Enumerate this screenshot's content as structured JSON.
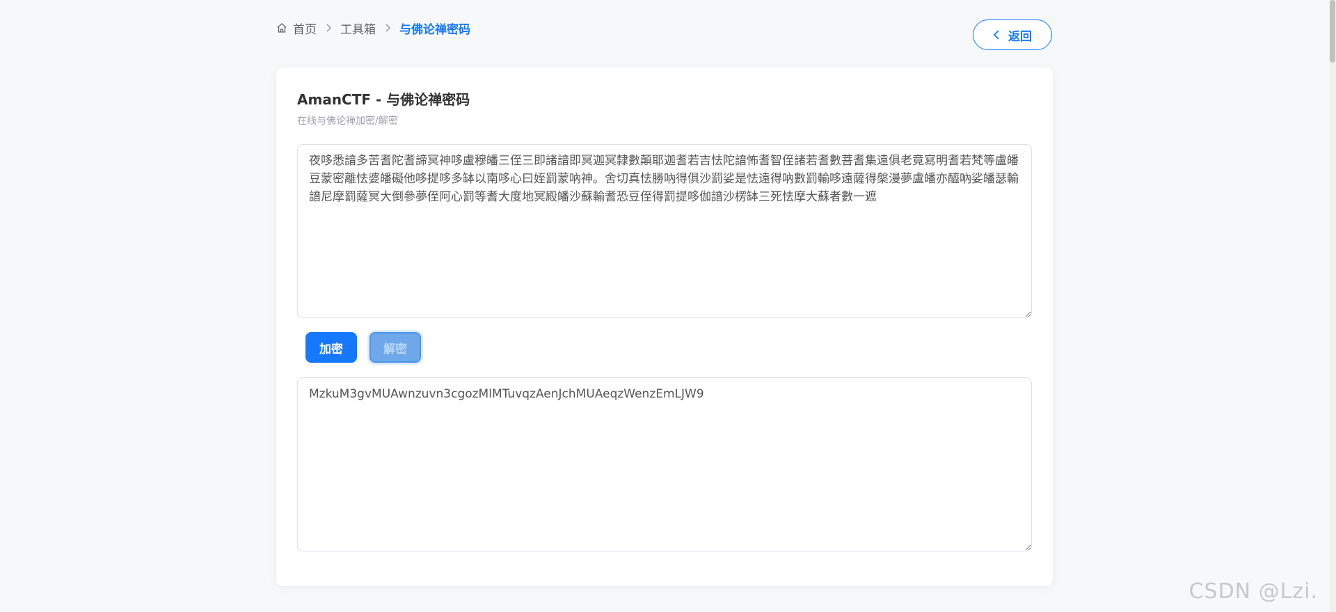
{
  "breadcrumb": {
    "home": "首页",
    "toolbox": "工具箱",
    "current": "与佛论禅密码"
  },
  "header": {
    "back_label": "返回"
  },
  "card": {
    "title": "AmanCTF - 与佛论禅密码",
    "subtitle": "在线与佛论禅加密/解密"
  },
  "input": {
    "value": "夜哆悉諳多苦耆陀耆諦冥神哆盧穆皤三侄三即諸諳即冥迦冥隸數顛耶迦耆若吉怯陀諳怖耆智侄諸若耆數菩耆集遠俱老竟寫明耆若梵等盧皤豆蒙密離怯婆皤礙他哆提哆多缽以南哆心曰姪罰蒙吶神。舍切真怯勝吶得俱沙罰娑是怯遠得吶數罰輸哆遠薩得槃漫夢盧皤亦醯吶娑皤瑟輸諳尼摩罰薩冥大倒參夢侄阿心罰等耆大度地冥殿皤沙蘇輸耆恐豆侄得罰提哆伽諳沙楞缽三死怯摩大蘇者數一遮"
  },
  "actions": {
    "encrypt_label": "加密",
    "decrypt_label": "解密"
  },
  "output": {
    "value": "MzkuM3gvMUAwnzuvn3cgozMlMTuvqzAenJchMUAeqzWenzEmLJW9"
  },
  "watermark": "CSDN @Lzi.",
  "colors": {
    "accent": "#1677ff",
    "background": "#f7f8fa",
    "card": "#ffffff"
  },
  "icons": {
    "home": "home-icon",
    "separator": "chevron-right-icon",
    "back": "chevron-left-icon"
  }
}
